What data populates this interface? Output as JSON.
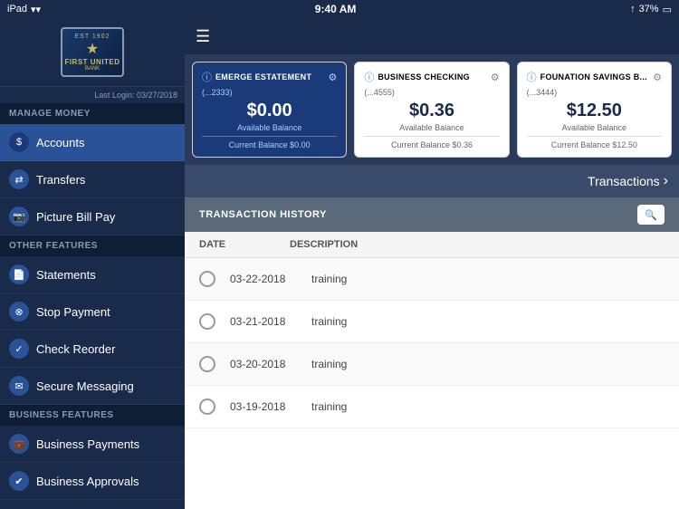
{
  "statusBar": {
    "left": "iPad",
    "wifi": "wifi",
    "time": "9:40 AM",
    "signal": "signal",
    "battery": "37%"
  },
  "sidebar": {
    "lastLogin": "Last Login: 03/27/2018",
    "logo": {
      "est": "EST 1902",
      "star": "★",
      "name": "FIRST UNITED",
      "bank": "BANK"
    },
    "sections": [
      {
        "header": "MANAGE MONEY",
        "items": [
          {
            "id": "accounts",
            "label": "Accounts",
            "icon": "$",
            "active": true
          },
          {
            "id": "transfers",
            "label": "Transfers",
            "icon": "⇄"
          },
          {
            "id": "picture-bill-pay",
            "label": "Picture Bill Pay",
            "icon": "📷"
          }
        ]
      },
      {
        "header": "OTHER FEATURES",
        "items": [
          {
            "id": "statements",
            "label": "Statements",
            "icon": "📄"
          },
          {
            "id": "stop-payment",
            "label": "Stop Payment",
            "icon": "⊗"
          },
          {
            "id": "check-reorder",
            "label": "Check Reorder",
            "icon": "✓"
          },
          {
            "id": "secure-messaging",
            "label": "Secure Messaging",
            "icon": "✉"
          }
        ]
      },
      {
        "header": "BUSINESS FEATURES",
        "items": [
          {
            "id": "business-payments",
            "label": "Business Payments",
            "icon": "💼"
          },
          {
            "id": "business-approvals",
            "label": "Business Approvals",
            "icon": "✔"
          }
        ]
      }
    ]
  },
  "accounts": [
    {
      "id": "emerge",
      "title": "EMERGE ESTATEMENT",
      "acctNum": "(...2333)",
      "balance": "$0.00",
      "availLabel": "Available Balance",
      "currentLabel": "Current Balance $0.00",
      "active": true
    },
    {
      "id": "checking",
      "title": "BUSINESS CHECKING",
      "acctNum": "(...4555)",
      "balance": "$0.36",
      "availLabel": "Available Balance",
      "currentLabel": "Current Balance $0.36",
      "active": false
    },
    {
      "id": "savings",
      "title": "FOUNATION SAVINGS B...",
      "acctNum": "(...3444)",
      "balance": "$12.50",
      "availLabel": "Available Balance",
      "currentLabel": "Current Balance $12.50",
      "active": false
    }
  ],
  "transactionsLink": "Transactions",
  "transactionHistory": {
    "title": "TRANSACTION HISTORY",
    "columns": [
      "DATE",
      "DESCRIPTION"
    ],
    "rows": [
      {
        "date": "03-22-2018",
        "description": "training"
      },
      {
        "date": "03-21-2018",
        "description": "training"
      },
      {
        "date": "03-20-2018",
        "description": "training"
      },
      {
        "date": "03-19-2018",
        "description": "training"
      }
    ]
  }
}
